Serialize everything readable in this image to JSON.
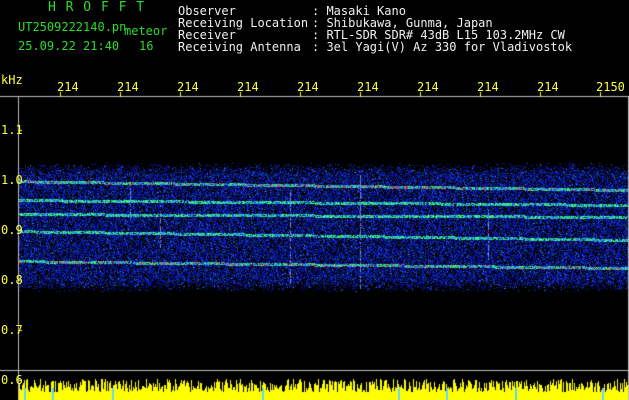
{
  "app": {
    "logo": "H R O F F T",
    "filename": "UT2509222140.pn",
    "filename_suffix": "meteor",
    "date_time": "25.09.22 21:40",
    "count": "16"
  },
  "info": [
    {
      "label": "Observer",
      "value": ": Masaki Kano"
    },
    {
      "label": "Receiving Location",
      "value": ": Shibukawa, Gunma, Japan"
    },
    {
      "label": "Receiver",
      "value": ": RTL-SDR SDR# 43dB L15 103.2MHz CW"
    },
    {
      "label": "Receiving Antenna",
      "value": ": 3el Yagi(V) Az 330 for Vladivostok"
    }
  ],
  "time_axis": {
    "unit_label": "kHz",
    "ticks": [
      "214",
      "214",
      "214",
      "214",
      "214",
      "214",
      "214",
      "214",
      "214",
      "2150"
    ]
  },
  "freq_axis": {
    "ticks": [
      "1.1",
      "1.0",
      "0.9",
      "0.8",
      "0.7",
      "0.6"
    ]
  },
  "colors": {
    "background": "#000000",
    "label_green": "#2bdc2b",
    "info_white": "#f0f0f0",
    "axis_yellow": "#ffff3a",
    "noise_blue": "#1230b0",
    "echo_green": "#30ff60",
    "echo_red": "#ff3030",
    "signal_bars": "#ffff00"
  }
}
